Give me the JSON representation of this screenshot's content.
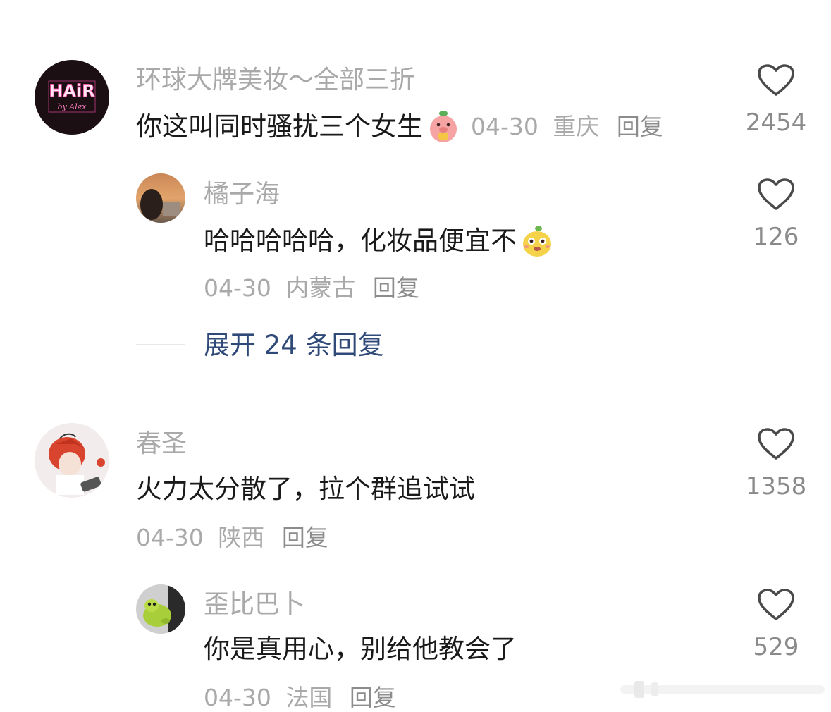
{
  "comments": [
    {
      "username": "环球大牌美妆～全部三折",
      "text": "你这叫同时骚扰三个女生",
      "emoji": "pink-pig-eating-emoji",
      "date": "04-30",
      "location": "重庆",
      "reply_label": "回复",
      "likes": "2454",
      "avatar_text_main": "HAiR",
      "avatar_text_sub": "by Alex"
    },
    {
      "username": "橘子海",
      "text": "哈哈哈哈哈，化妆品便宜不",
      "emoji": "yellow-mango-face-emoji",
      "date": "04-30",
      "location": "内蒙古",
      "reply_label": "回复",
      "likes": "126"
    },
    {
      "username": "春圣",
      "text": "火力太分散了，拉个群追试试",
      "date": "04-30",
      "location": "陕西",
      "reply_label": "回复",
      "likes": "1358"
    },
    {
      "username": "歪比巴卜",
      "text": "你是真用心，别给他教会了",
      "date": "04-30",
      "location": "法国",
      "reply_label": "回复",
      "likes": "529"
    }
  ],
  "expand_replies": {
    "label": "展开 24 条回复"
  },
  "colors": {
    "username": "#a9a9a9",
    "text": "#1a1a1a",
    "meta": "#a9a9a9",
    "expand_link": "#2f4a78",
    "like_icon": "#4a4a4a"
  },
  "icons": {
    "like": "heart-outline-icon"
  }
}
